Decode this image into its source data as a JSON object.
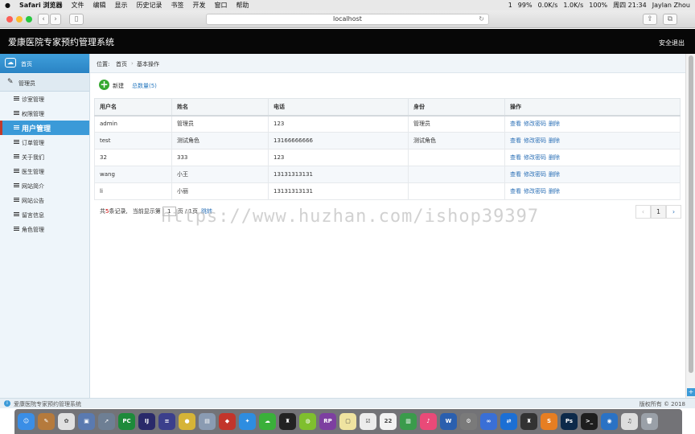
{
  "menubar": {
    "app": "Safari 浏览器",
    "items": [
      "文件",
      "编辑",
      "显示",
      "历史记录",
      "书签",
      "开发",
      "窗口",
      "帮助"
    ],
    "status": {
      "notify": "1",
      "battery_small": "99%",
      "net_up": "0.0K/s",
      "net_down": "1.0K/s",
      "battery": "100%",
      "day_time": "周四 21:34",
      "user": "Jaylan Zhou"
    }
  },
  "browser": {
    "url": "localhost",
    "reload": "↻"
  },
  "app": {
    "title": "爱康医院专家预约管理系统",
    "logout": "安全退出"
  },
  "sidebar": {
    "home": "首页",
    "group": "管理员",
    "items": [
      {
        "label": "诊室管理"
      },
      {
        "label": "权限管理"
      },
      {
        "label": "用户管理"
      },
      {
        "label": "订单管理"
      },
      {
        "label": "关于我们"
      },
      {
        "label": "医生管理"
      },
      {
        "label": "网站简介"
      },
      {
        "label": "网站公告"
      },
      {
        "label": "留言信息"
      },
      {
        "label": "角色管理"
      }
    ]
  },
  "breadcrumb": {
    "label": "位置:",
    "home": "首页",
    "sep": "›",
    "current": "基本操作"
  },
  "toolbar": {
    "plus": "+",
    "new": "新建",
    "total": "总数量(5)"
  },
  "table": {
    "headers": [
      "用户名",
      "姓名",
      "电话",
      "身份",
      "操作"
    ],
    "rows": [
      {
        "username": "admin",
        "name": "管理员",
        "phone": "123",
        "role": "管理员"
      },
      {
        "username": "test",
        "name": "测试角色",
        "phone": "13166666666",
        "role": "测试角色"
      },
      {
        "username": "32",
        "name": "333",
        "phone": "123",
        "role": ""
      },
      {
        "username": "wang",
        "name": "小王",
        "phone": "13131313131",
        "role": ""
      },
      {
        "username": "li",
        "name": "小丽",
        "phone": "13131313131",
        "role": ""
      }
    ],
    "actions": {
      "view": "查看",
      "change_pwd": "修改密码",
      "delete": "删除"
    }
  },
  "pager": {
    "pre": "共",
    "count": "5",
    "post": "条记录,",
    "show": "当前显示第",
    "page_input": "1",
    "pages": "页 / 1页",
    "jump": "跳转",
    "prev": "‹",
    "current": "1",
    "next": "›"
  },
  "watermark": "https://www.huzhan.com/ishop39397",
  "status": {
    "info": "i",
    "text": "爱康医院专家预约管理系统",
    "copyright": "版权所有 © 2018"
  },
  "dock": {
    "apps": [
      {
        "name": "finder",
        "label": "☺",
        "color": "#3a8ee6"
      },
      {
        "name": "notes",
        "label": "✎",
        "color": "#b57a3c"
      },
      {
        "name": "photos",
        "label": "✿",
        "color": "#e0e0e0"
      },
      {
        "name": "preview",
        "label": "▣",
        "color": "#5a7ab0"
      },
      {
        "name": "launchpad",
        "label": "➚",
        "color": "#6e7f94"
      },
      {
        "name": "pycharm",
        "label": "PC",
        "color": "#1d8a3a"
      },
      {
        "name": "intellij",
        "label": "IJ",
        "color": "#2a2a6a"
      },
      {
        "name": "eclipse",
        "label": "≡",
        "color": "#3b3f8c"
      },
      {
        "name": "navicat",
        "label": "●",
        "color": "#d6b437"
      },
      {
        "name": "disk",
        "label": "▤",
        "color": "#8a9bb2"
      },
      {
        "name": "redis",
        "label": "◆",
        "color": "#c2352b"
      },
      {
        "name": "safari",
        "label": "✦",
        "color": "#2e8de0"
      },
      {
        "name": "wechat",
        "label": "☁",
        "color": "#3ab03a"
      },
      {
        "name": "qq",
        "label": "♜",
        "color": "#222"
      },
      {
        "name": "weather",
        "label": "◍",
        "color": "#7fbf2e"
      },
      {
        "name": "axure",
        "label": "RP",
        "color": "#7d3fa0"
      },
      {
        "name": "stickies",
        "label": "▢",
        "color": "#efe3a0"
      },
      {
        "name": "reminders",
        "label": "☑",
        "color": "#ececec"
      },
      {
        "name": "calendar",
        "label": "22",
        "color": "#f2f2f2"
      },
      {
        "name": "numbers",
        "label": "▥",
        "color": "#3a9b4b"
      },
      {
        "name": "music",
        "label": "♪",
        "color": "#e94a78"
      },
      {
        "name": "word",
        "label": "W",
        "color": "#2b5fae"
      },
      {
        "name": "prefs",
        "label": "⚙",
        "color": "#7a7a7a"
      },
      {
        "name": "baidu-netdisk",
        "label": "∞",
        "color": "#3a6fd6"
      },
      {
        "name": "teamviewer",
        "label": "⇄",
        "color": "#1c6fd4"
      },
      {
        "name": "qq2",
        "label": "♜",
        "color": "#333"
      },
      {
        "name": "sublime",
        "label": "S",
        "color": "#e67e22"
      },
      {
        "name": "photoshop",
        "label": "Ps",
        "color": "#0d2a4a"
      },
      {
        "name": "terminal",
        "label": ">_",
        "color": "#1e1e1e"
      },
      {
        "name": "chrome-canary",
        "label": "◉",
        "color": "#2a72c4"
      },
      {
        "name": "itunes",
        "label": "♫",
        "color": "#ddd"
      },
      {
        "name": "trash",
        "label": "🗑",
        "color": "#9aa0a8"
      }
    ]
  },
  "colors": {
    "accent": "#3b9ad8",
    "header": "#070707",
    "link": "#2a6fb6",
    "new_icon": "#36a830"
  }
}
